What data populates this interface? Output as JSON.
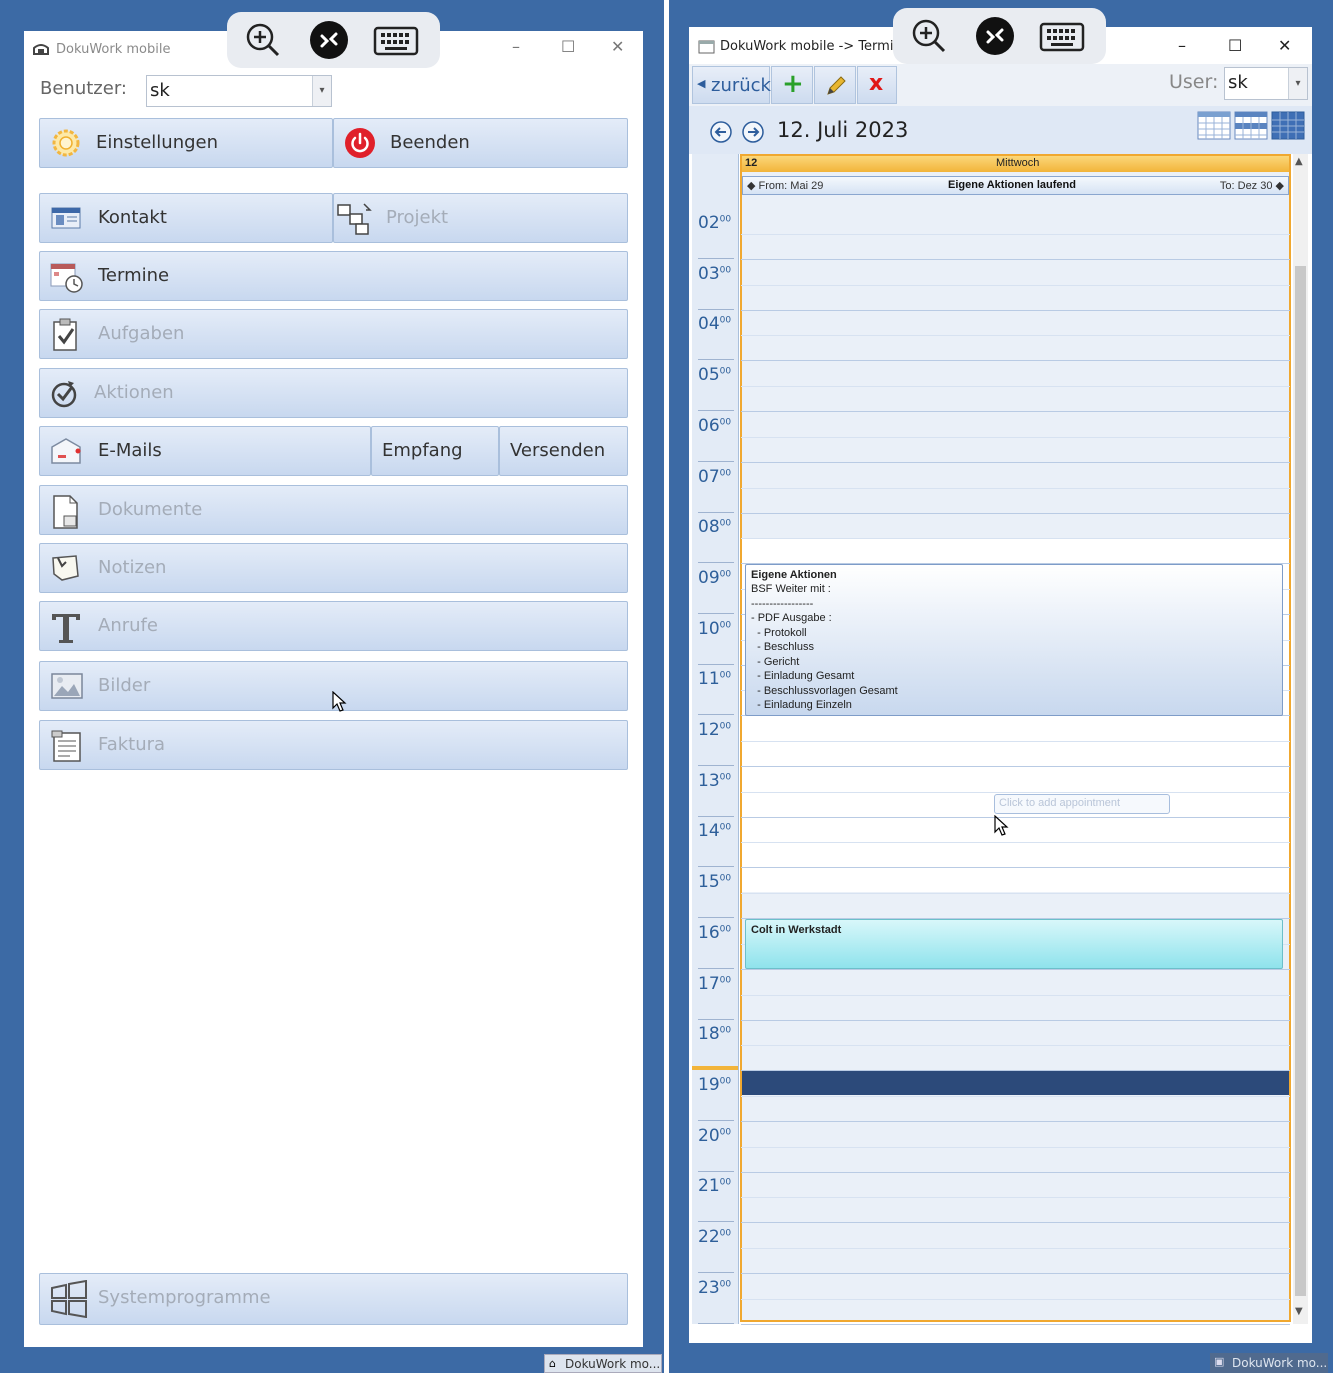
{
  "left_window": {
    "title": "DokuWork mobile",
    "user_label": "Benutzer:",
    "user_value": "sk",
    "buttons": {
      "settings": "Einstellungen",
      "quit": "Beenden",
      "contact": "Kontakt",
      "project": "Projekt",
      "appointments": "Termine",
      "tasks": "Aufgaben",
      "actions": "Aktionen",
      "emails": "E-Mails",
      "receive": "Empfang",
      "send": "Versenden",
      "documents": "Dokumente",
      "notes": "Notizen",
      "calls": "Anrufe",
      "images": "Bilder",
      "invoicing": "Faktura",
      "system_programs": "Systemprogramme"
    },
    "taskbar_label": "DokuWork mo..."
  },
  "right_window": {
    "title": "DokuWork mobile -> Termine",
    "back_label": "zurück",
    "add_symbol": "+",
    "delete_symbol": "x",
    "user_label": "User:",
    "user_value": "sk",
    "date": "12. Juli 2023",
    "day_number": "12",
    "weekday": "Mittwoch",
    "from_label": "From: Mai 29",
    "ongoing_label": "Eigene Aktionen laufend",
    "to_label": "To: Dez 30",
    "hours": [
      "02",
      "03",
      "04",
      "05",
      "06",
      "07",
      "08",
      "09",
      "10",
      "11",
      "12",
      "13",
      "14",
      "15",
      "16",
      "17",
      "18",
      "19",
      "20",
      "21",
      "22",
      "23"
    ],
    "hour_suffix": "00",
    "appointment1": {
      "title": "Eigene Aktionen",
      "lines": [
        "BSF Weiter mit :",
        "-----------------",
        "- PDF Ausgabe :",
        "  - Protokoll",
        "  - Beschluss",
        "  - Gericht",
        "  - Einladung Gesamt",
        "  - Beschlussvorlagen Gesamt",
        "  - Einladung Einzeln"
      ]
    },
    "appointment2": {
      "title": "Colt in Werkstadt"
    },
    "click_hint": "Click to add appointment",
    "taskbar_label": "DokuWork mo..."
  },
  "colors": {
    "desktop": "#3c6aa5",
    "button_gradient_top": "#e4ecf8",
    "button_gradient_bottom": "#c8d8ef",
    "today_header": "#f5c040",
    "appointment_cyan": "#a8ecf3",
    "selected_row": "#2c4a7a",
    "quit_red": "#e0202a"
  },
  "icons": [
    "zoom-in-icon",
    "remote-desktop-icon",
    "keyboard-icon",
    "settings-gear-icon",
    "power-icon",
    "contact-card-icon",
    "project-icon",
    "calendar-icon",
    "tasks-checklist-icon",
    "actions-icon",
    "email-icon",
    "document-icon",
    "notes-icon",
    "calls-icon",
    "images-icon",
    "invoice-icon",
    "windows-logo-icon",
    "back-arrow-icon",
    "forward-arrow-icon",
    "day-view-icon",
    "week-view-icon",
    "month-view-icon",
    "pencil-icon"
  ]
}
